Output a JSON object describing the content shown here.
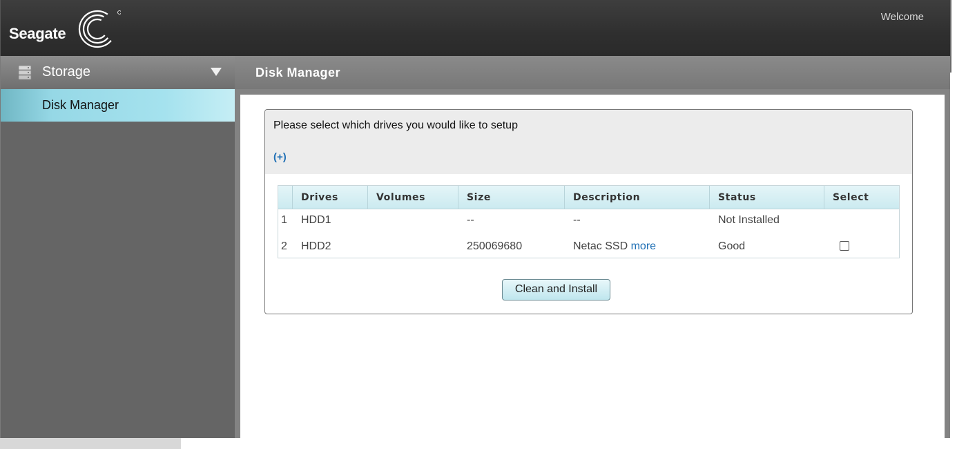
{
  "header": {
    "brand": "Seagate",
    "welcome": "Welcome"
  },
  "sidebar": {
    "section_title": "Storage",
    "section_icon": "database-icon",
    "items": [
      {
        "label": "Disk Manager",
        "selected": true
      }
    ]
  },
  "main": {
    "title": "Disk Manager",
    "instruction": "Please select which drives you would like to setup",
    "expand_link": "(+)",
    "table": {
      "columns": [
        "Drives",
        "Volumes",
        "Size",
        "Description",
        "Status",
        "Select"
      ],
      "rows": [
        {
          "index": "1",
          "drive": "HDD1",
          "volumes": "",
          "size": "--",
          "description": "--",
          "more": "",
          "status": "Not Installed",
          "selectable": false
        },
        {
          "index": "2",
          "drive": "HDD2",
          "volumes": "",
          "size": "250069680",
          "description": "Netac SSD",
          "more": "more",
          "status": "Good",
          "selectable": true,
          "checked": false
        }
      ]
    },
    "action_button": "Clean and Install"
  },
  "colors": {
    "topbar": "#2f2f2f",
    "sidebar": "#656565",
    "selected_item": "#a5e2ee",
    "link": "#1f6fb5"
  }
}
